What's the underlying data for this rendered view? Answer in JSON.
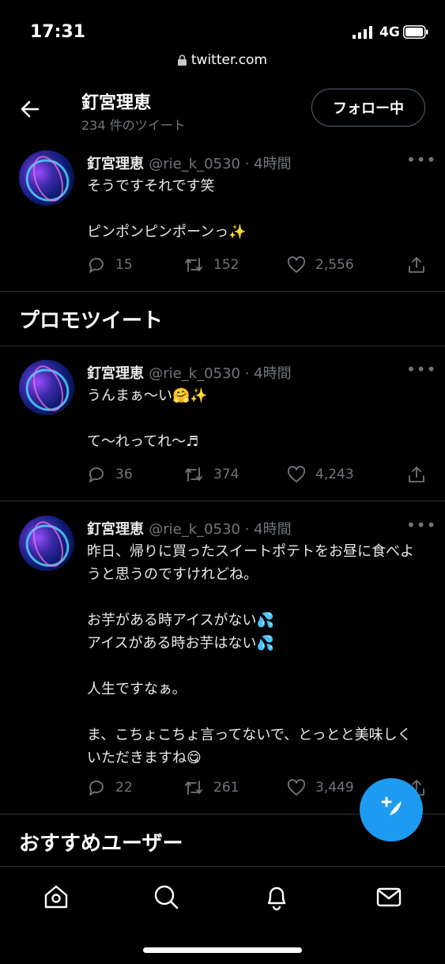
{
  "status": {
    "time": "17:31",
    "network": "4G"
  },
  "browser": {
    "url": "twitter.com"
  },
  "header": {
    "name": "釘宮理恵",
    "tweet_count": "234 件のツイート",
    "follow_label": "フォロー中"
  },
  "tweets": [
    {
      "name": "釘宮理恵",
      "meta": "@rie_k_0530 · 4時間",
      "text": "そうですそれです笑\n\nピンポンピンポーンっ✨",
      "replies": "15",
      "retweets": "152",
      "likes": "2,556"
    },
    {
      "name": "釘宮理恵",
      "meta": "@rie_k_0530 · 4時間",
      "text": "うんまぁ〜い🤗✨\n\nて〜れってれ〜♬",
      "replies": "36",
      "retweets": "374",
      "likes": "4,243"
    },
    {
      "name": "釘宮理恵",
      "meta": "@rie_k_0530 · 4時間",
      "text": "昨日、帰りに買ったスイートポテトをお昼に食べようと思うのですけれどね。\n\nお芋がある時アイスがない💦\nアイスがある時お芋はない💦\n\n人生ですなぁ。\n\nま、こちょこちょ言ってないで、とっとと美味しくいただきますね😋",
      "replies": "22",
      "retweets": "261",
      "likes": "3,449"
    }
  ],
  "sections": {
    "promo": "プロモツイート",
    "recommended": "おすすめユーザー"
  },
  "icons": {
    "back": "arrow-left-icon",
    "reply": "comment-icon",
    "retweet": "retweet-icon",
    "like": "heart-icon",
    "share": "share-icon",
    "compose": "feather-plus-icon",
    "home": "home-icon",
    "search": "search-icon",
    "notifications": "bell-icon",
    "messages": "mail-icon"
  },
  "colors": {
    "accent": "#1d9bf0",
    "background": "#000000",
    "muted": "#71767b",
    "divider": "#2f3336"
  }
}
